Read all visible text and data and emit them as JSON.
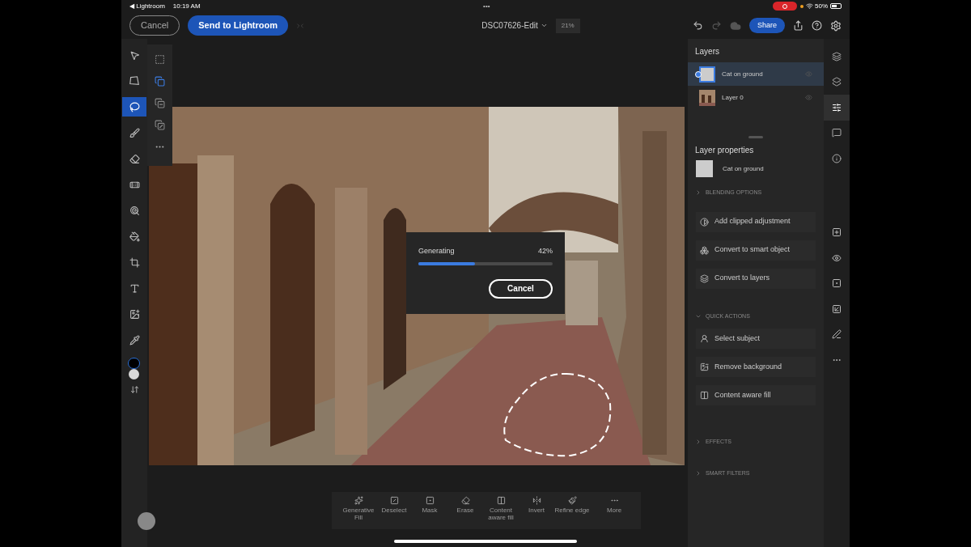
{
  "status_bar": {
    "back_app": "◀ Lightroom",
    "time": "10:19 AM",
    "multitask": "•••",
    "battery": "50%"
  },
  "top_bar": {
    "cancel": "Cancel",
    "send": "Send to Lightroom",
    "document": "DSC07626-Edit",
    "zoom": "21%",
    "share": "Share"
  },
  "tools": [
    {
      "selected": false
    },
    {
      "selected": false
    },
    {
      "selected": true
    },
    {
      "selected": false
    },
    {
      "selected": false
    },
    {
      "selected": false
    },
    {
      "selected": false
    },
    {
      "selected": false
    },
    {
      "selected": false
    },
    {
      "selected": false
    },
    {
      "selected": false
    },
    {
      "selected": false
    }
  ],
  "panel_tabs": [
    {
      "selected": false
    },
    {
      "selected": false
    },
    {
      "selected": true
    },
    {
      "selected": false
    },
    {
      "selected": false
    }
  ],
  "selection_options": [
    {
      "selected": false
    },
    {
      "selected": true
    },
    {
      "selected": false
    },
    {
      "selected": false
    }
  ],
  "progress": {
    "label": "Generating",
    "percent": "42%",
    "level": 0.42,
    "button": "Cancel"
  },
  "bottom_toolbar": [
    {
      "label": "Generative Fill"
    },
    {
      "label": "Deselect"
    },
    {
      "label": "Mask"
    },
    {
      "label": "Erase"
    },
    {
      "label": "Content aware fill"
    },
    {
      "label": "Invert"
    },
    {
      "label": "Refine edge"
    },
    {
      "label": "More"
    }
  ],
  "layers": {
    "title": "Layers",
    "items": [
      {
        "name": "Cat on ground",
        "selected": true,
        "kind": "blank"
      },
      {
        "name": "Layer 0",
        "selected": false
      }
    ]
  },
  "layer_properties": {
    "title": "Layer properties",
    "name": "Cat on ground",
    "items": [
      {
        "kind": "section",
        "label": "BLENDING OPTIONS",
        "expanded": false
      },
      {
        "kind": "action",
        "label": "Add clipped adjustment"
      },
      {
        "kind": "action",
        "label": "Convert to smart object"
      },
      {
        "kind": "action",
        "label": "Convert to layers"
      },
      {
        "kind": "section",
        "label": "QUICK ACTIONS",
        "expanded": true
      },
      {
        "kind": "action",
        "label": "Select subject"
      },
      {
        "kind": "action",
        "label": "Remove background"
      },
      {
        "kind": "action",
        "label": "Content aware fill"
      },
      {
        "kind": "section",
        "label": "EFFECTS",
        "expanded": false
      },
      {
        "kind": "section",
        "label": "SMART FILTERS",
        "expanded": false
      }
    ]
  }
}
